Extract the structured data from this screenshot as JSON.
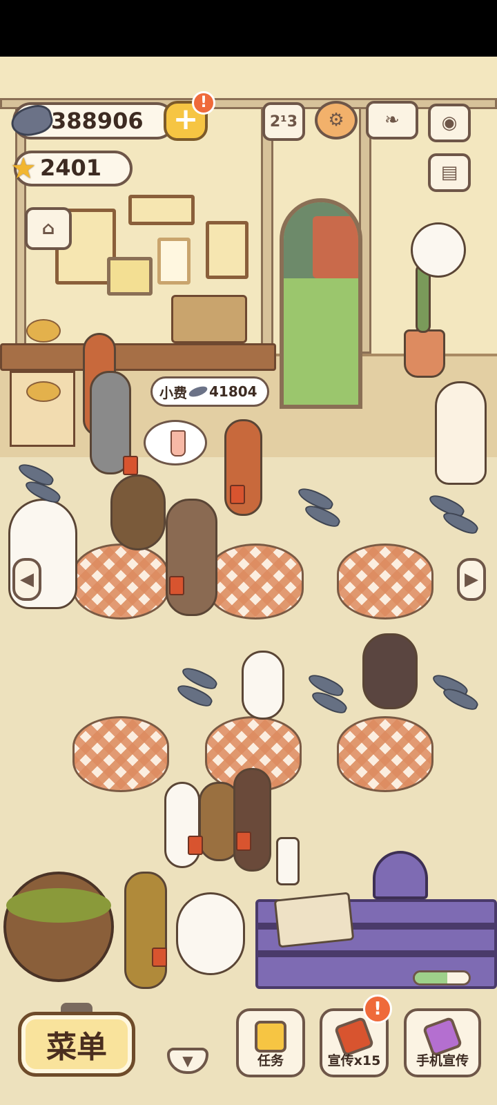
{
  "hud": {
    "fish_currency": "388906",
    "star_currency": "2401",
    "plus_badge": "!"
  },
  "tip": {
    "label": "小费",
    "amount": "41804"
  },
  "nav": {
    "left_arrow": "◀",
    "right_arrow": "▶",
    "down_arrow": "▼"
  },
  "top_icons": {
    "ranking": "2¹3",
    "ranking_icon": "podium-icon",
    "settings_icon": "gear-icon",
    "collection_icon": "book-icon",
    "camera_icon": "camera-icon",
    "news_icon": "newspaper-icon",
    "shop_icon": "shop-icon"
  },
  "bottom": {
    "menu_label": "菜单",
    "tasks_label": "任务",
    "promote_label": "宣传x15",
    "promote_badge": "!",
    "phone_promote_label": "手机宣传",
    "phone_progress": 0.6
  },
  "colors": {
    "wall": "#f3e7bf",
    "floor": "#ede1bd",
    "accent_yellow": "#f6c543",
    "badge_orange": "#ef6a3a",
    "outline_brown": "#6e5648"
  }
}
